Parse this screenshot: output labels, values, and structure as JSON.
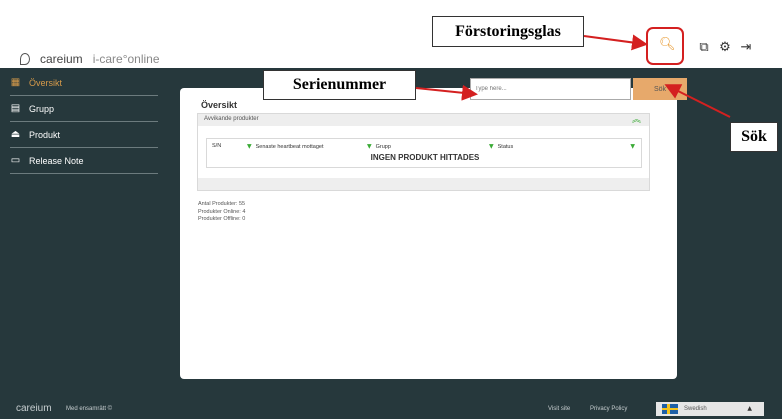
{
  "header": {
    "brand": "careium",
    "product": "i-care°online",
    "icons": [
      "search-icon",
      "external-link-icon",
      "gear-icon",
      "logout-icon"
    ]
  },
  "sidebar": {
    "items": [
      {
        "label": "Översikt",
        "icon": "grid-icon",
        "active": true
      },
      {
        "label": "Grupp",
        "icon": "building-icon",
        "active": false
      },
      {
        "label": "Produkt",
        "icon": "product-icon",
        "active": false
      },
      {
        "label": "Release Note",
        "icon": "folder-icon",
        "active": false
      }
    ]
  },
  "search": {
    "placeholder": "Type here...",
    "button_label": "Sök"
  },
  "main": {
    "title": "Översikt",
    "section_label": "Avvikande produkter",
    "columns": [
      "S/N",
      "Senaste heartbeat mottaget",
      "Grupp",
      "Status"
    ],
    "empty_message": "INGEN PRODUKT HITTADES",
    "stats": [
      "Antal Produkter: 55",
      "Produkter Online: 4",
      "Produkter Offline: 0"
    ]
  },
  "annotations": {
    "magnifier": "Förstoringsglas",
    "serial": "Serienummer",
    "search": "Sök"
  },
  "footer": {
    "brand": "careium",
    "copyright": "Med ensamrätt ©",
    "visit": "Visit site",
    "privacy": "Privacy Policy",
    "language": "Swedish"
  },
  "colors": {
    "sidebar_bg": "#26383c",
    "accent": "#d79b4a",
    "search_button": "#e7a96b",
    "annotation_red": "#d42020",
    "chevron_green": "#3aaa35"
  }
}
